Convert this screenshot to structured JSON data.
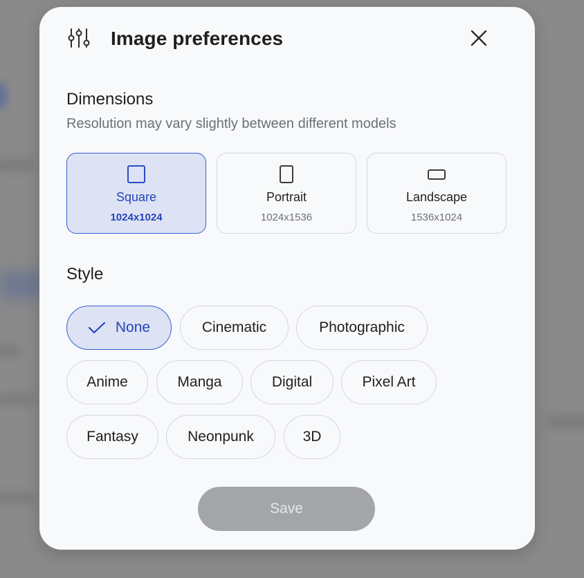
{
  "modal": {
    "title": "Image preferences",
    "icons": {
      "header": "sliders-icon",
      "close": "close-icon"
    }
  },
  "dimensions": {
    "title": "Dimensions",
    "subtitle": "Resolution may vary slightly between different models",
    "options": [
      {
        "label": "Square",
        "size": "1024x1024",
        "selected": true,
        "icon": "square-icon"
      },
      {
        "label": "Portrait",
        "size": "1024x1536",
        "selected": false,
        "icon": "portrait-icon"
      },
      {
        "label": "Landscape",
        "size": "1536x1024",
        "selected": false,
        "icon": "landscape-icon"
      }
    ]
  },
  "style": {
    "title": "Style",
    "options": [
      {
        "label": "None",
        "selected": true
      },
      {
        "label": "Cinematic",
        "selected": false
      },
      {
        "label": "Photographic",
        "selected": false
      },
      {
        "label": "Anime",
        "selected": false
      },
      {
        "label": "Manga",
        "selected": false
      },
      {
        "label": "Digital",
        "selected": false
      },
      {
        "label": "Pixel Art",
        "selected": false
      },
      {
        "label": "Fantasy",
        "selected": false
      },
      {
        "label": "Neonpunk",
        "selected": false
      },
      {
        "label": "3D",
        "selected": false
      }
    ]
  },
  "actions": {
    "save_label": "Save",
    "save_enabled": false
  },
  "colors": {
    "accent": "#3a5bd6",
    "accent_text": "#2643b8",
    "selected_bg": "#dde3f5",
    "disabled_button": "#a3a5a8",
    "overlay": "#8a8a8a"
  }
}
